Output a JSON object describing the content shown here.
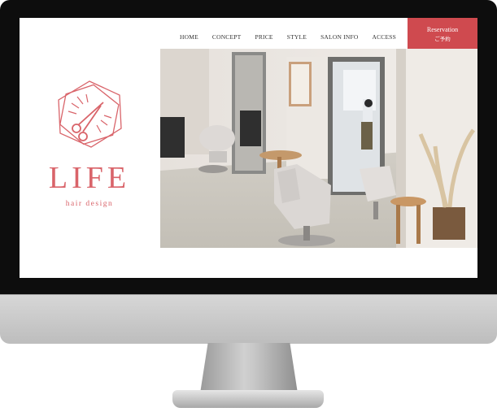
{
  "nav": {
    "items": [
      {
        "label": "HOME"
      },
      {
        "label": "CONCEPT"
      },
      {
        "label": "PRICE"
      },
      {
        "label": "STYLE"
      },
      {
        "label": "SALON INFO"
      },
      {
        "label": "ACCESS"
      }
    ],
    "reservation": {
      "label_en": "Reservation",
      "label_jp": "ご予約"
    }
  },
  "logo": {
    "wordmark": "LIFE",
    "tagline": "hair design",
    "icon": "scissors-icon",
    "color": "#d9646a"
  },
  "theme": {
    "accent": "#cf4a4f",
    "frame": "#0d0d0d"
  }
}
